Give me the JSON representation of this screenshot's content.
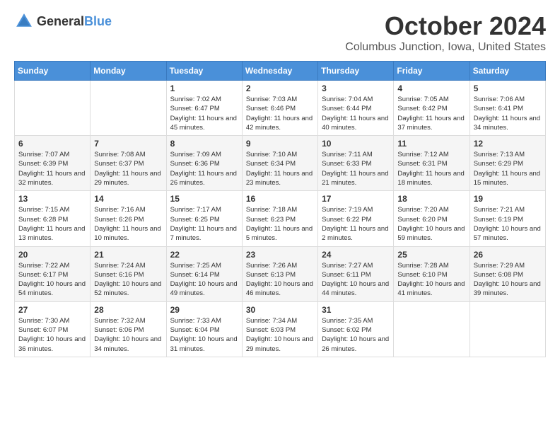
{
  "logo": {
    "text_general": "General",
    "text_blue": "Blue"
  },
  "header": {
    "month": "October 2024",
    "location": "Columbus Junction, Iowa, United States"
  },
  "weekdays": [
    "Sunday",
    "Monday",
    "Tuesday",
    "Wednesday",
    "Thursday",
    "Friday",
    "Saturday"
  ],
  "weeks": [
    [
      {
        "day": "",
        "sunrise": "",
        "sunset": "",
        "daylight": ""
      },
      {
        "day": "",
        "sunrise": "",
        "sunset": "",
        "daylight": ""
      },
      {
        "day": "1",
        "sunrise": "Sunrise: 7:02 AM",
        "sunset": "Sunset: 6:47 PM",
        "daylight": "Daylight: 11 hours and 45 minutes."
      },
      {
        "day": "2",
        "sunrise": "Sunrise: 7:03 AM",
        "sunset": "Sunset: 6:46 PM",
        "daylight": "Daylight: 11 hours and 42 minutes."
      },
      {
        "day": "3",
        "sunrise": "Sunrise: 7:04 AM",
        "sunset": "Sunset: 6:44 PM",
        "daylight": "Daylight: 11 hours and 40 minutes."
      },
      {
        "day": "4",
        "sunrise": "Sunrise: 7:05 AM",
        "sunset": "Sunset: 6:42 PM",
        "daylight": "Daylight: 11 hours and 37 minutes."
      },
      {
        "day": "5",
        "sunrise": "Sunrise: 7:06 AM",
        "sunset": "Sunset: 6:41 PM",
        "daylight": "Daylight: 11 hours and 34 minutes."
      }
    ],
    [
      {
        "day": "6",
        "sunrise": "Sunrise: 7:07 AM",
        "sunset": "Sunset: 6:39 PM",
        "daylight": "Daylight: 11 hours and 32 minutes."
      },
      {
        "day": "7",
        "sunrise": "Sunrise: 7:08 AM",
        "sunset": "Sunset: 6:37 PM",
        "daylight": "Daylight: 11 hours and 29 minutes."
      },
      {
        "day": "8",
        "sunrise": "Sunrise: 7:09 AM",
        "sunset": "Sunset: 6:36 PM",
        "daylight": "Daylight: 11 hours and 26 minutes."
      },
      {
        "day": "9",
        "sunrise": "Sunrise: 7:10 AM",
        "sunset": "Sunset: 6:34 PM",
        "daylight": "Daylight: 11 hours and 23 minutes."
      },
      {
        "day": "10",
        "sunrise": "Sunrise: 7:11 AM",
        "sunset": "Sunset: 6:33 PM",
        "daylight": "Daylight: 11 hours and 21 minutes."
      },
      {
        "day": "11",
        "sunrise": "Sunrise: 7:12 AM",
        "sunset": "Sunset: 6:31 PM",
        "daylight": "Daylight: 11 hours and 18 minutes."
      },
      {
        "day": "12",
        "sunrise": "Sunrise: 7:13 AM",
        "sunset": "Sunset: 6:29 PM",
        "daylight": "Daylight: 11 hours and 15 minutes."
      }
    ],
    [
      {
        "day": "13",
        "sunrise": "Sunrise: 7:15 AM",
        "sunset": "Sunset: 6:28 PM",
        "daylight": "Daylight: 11 hours and 13 minutes."
      },
      {
        "day": "14",
        "sunrise": "Sunrise: 7:16 AM",
        "sunset": "Sunset: 6:26 PM",
        "daylight": "Daylight: 11 hours and 10 minutes."
      },
      {
        "day": "15",
        "sunrise": "Sunrise: 7:17 AM",
        "sunset": "Sunset: 6:25 PM",
        "daylight": "Daylight: 11 hours and 7 minutes."
      },
      {
        "day": "16",
        "sunrise": "Sunrise: 7:18 AM",
        "sunset": "Sunset: 6:23 PM",
        "daylight": "Daylight: 11 hours and 5 minutes."
      },
      {
        "day": "17",
        "sunrise": "Sunrise: 7:19 AM",
        "sunset": "Sunset: 6:22 PM",
        "daylight": "Daylight: 11 hours and 2 minutes."
      },
      {
        "day": "18",
        "sunrise": "Sunrise: 7:20 AM",
        "sunset": "Sunset: 6:20 PM",
        "daylight": "Daylight: 10 hours and 59 minutes."
      },
      {
        "day": "19",
        "sunrise": "Sunrise: 7:21 AM",
        "sunset": "Sunset: 6:19 PM",
        "daylight": "Daylight: 10 hours and 57 minutes."
      }
    ],
    [
      {
        "day": "20",
        "sunrise": "Sunrise: 7:22 AM",
        "sunset": "Sunset: 6:17 PM",
        "daylight": "Daylight: 10 hours and 54 minutes."
      },
      {
        "day": "21",
        "sunrise": "Sunrise: 7:24 AM",
        "sunset": "Sunset: 6:16 PM",
        "daylight": "Daylight: 10 hours and 52 minutes."
      },
      {
        "day": "22",
        "sunrise": "Sunrise: 7:25 AM",
        "sunset": "Sunset: 6:14 PM",
        "daylight": "Daylight: 10 hours and 49 minutes."
      },
      {
        "day": "23",
        "sunrise": "Sunrise: 7:26 AM",
        "sunset": "Sunset: 6:13 PM",
        "daylight": "Daylight: 10 hours and 46 minutes."
      },
      {
        "day": "24",
        "sunrise": "Sunrise: 7:27 AM",
        "sunset": "Sunset: 6:11 PM",
        "daylight": "Daylight: 10 hours and 44 minutes."
      },
      {
        "day": "25",
        "sunrise": "Sunrise: 7:28 AM",
        "sunset": "Sunset: 6:10 PM",
        "daylight": "Daylight: 10 hours and 41 minutes."
      },
      {
        "day": "26",
        "sunrise": "Sunrise: 7:29 AM",
        "sunset": "Sunset: 6:08 PM",
        "daylight": "Daylight: 10 hours and 39 minutes."
      }
    ],
    [
      {
        "day": "27",
        "sunrise": "Sunrise: 7:30 AM",
        "sunset": "Sunset: 6:07 PM",
        "daylight": "Daylight: 10 hours and 36 minutes."
      },
      {
        "day": "28",
        "sunrise": "Sunrise: 7:32 AM",
        "sunset": "Sunset: 6:06 PM",
        "daylight": "Daylight: 10 hours and 34 minutes."
      },
      {
        "day": "29",
        "sunrise": "Sunrise: 7:33 AM",
        "sunset": "Sunset: 6:04 PM",
        "daylight": "Daylight: 10 hours and 31 minutes."
      },
      {
        "day": "30",
        "sunrise": "Sunrise: 7:34 AM",
        "sunset": "Sunset: 6:03 PM",
        "daylight": "Daylight: 10 hours and 29 minutes."
      },
      {
        "day": "31",
        "sunrise": "Sunrise: 7:35 AM",
        "sunset": "Sunset: 6:02 PM",
        "daylight": "Daylight: 10 hours and 26 minutes."
      },
      {
        "day": "",
        "sunrise": "",
        "sunset": "",
        "daylight": ""
      },
      {
        "day": "",
        "sunrise": "",
        "sunset": "",
        "daylight": ""
      }
    ]
  ]
}
